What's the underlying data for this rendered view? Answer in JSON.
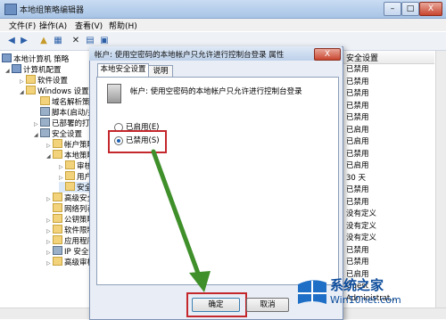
{
  "window": {
    "title": "本地组策略编辑器"
  },
  "menu": [
    "文件(F)",
    "操作(A)",
    "查看(V)",
    "帮助(H)"
  ],
  "tree": [
    "本地计算机 策略",
    "计算机配置",
    "软件设置",
    "Windows 设置",
    "域名解析策",
    "脚本(启动/关",
    "已部署的打",
    "安全设置",
    "帐户策略",
    "本地策略",
    "审核",
    "用户",
    "安全",
    "高级安全",
    "网络列表",
    "公钥策略",
    "软件限制",
    "应用程序",
    "IP 安全策",
    "高级审核"
  ],
  "right_column": {
    "header": "安全设置",
    "values": [
      "已禁用",
      "已禁用",
      "已禁用",
      "已禁用",
      "已禁用",
      "已启用",
      "已启用",
      "已禁用",
      "已启用",
      "30 天",
      "已禁用",
      "已禁用",
      "没有定义",
      "没有定义",
      "没有定义",
      "已禁用",
      "已禁用",
      "已启用",
      "Guest",
      "Administrat..."
    ]
  },
  "dialog": {
    "title": "帐户: 使用空密码的本地帐户只允许进行控制台登录 属性",
    "tabs": [
      "本地安全设置",
      "说明"
    ],
    "policy_text": "帐户: 使用空密码的本地帐户只允许进行控制台登录",
    "radio_enabled": "已启用(E)",
    "radio_disabled": "已禁用(S)",
    "ok": "确定",
    "cancel": "取消",
    "close": "X"
  },
  "watermark": {
    "site": "系统之家",
    "url": "Win10net.com"
  },
  "colors": {
    "highlight": "#c4272c",
    "arrow": "#3f8f2a",
    "accent": "#0e4d9c"
  }
}
